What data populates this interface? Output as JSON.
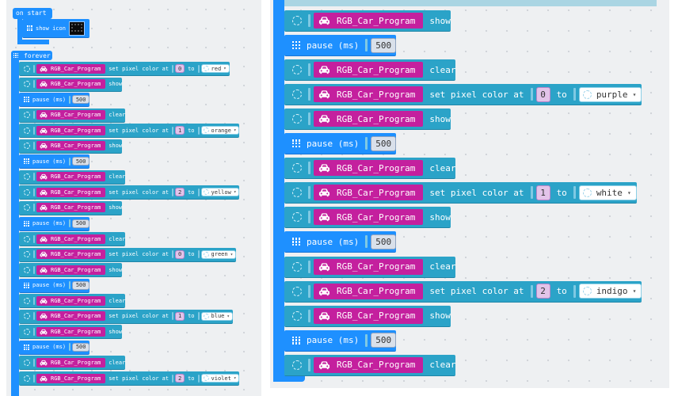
{
  "object_name": "RGB_Car_Program",
  "labels": {
    "on_start": "on start",
    "show_icon": "show icon",
    "forever": "forever",
    "set_pixel": "set pixel color at",
    "to": "to",
    "show": "show",
    "clear": "clear",
    "pause": "pause (ms)"
  },
  "pause_value": "500",
  "left_blocks": [
    {
      "kind": "set",
      "index": "0",
      "color": "red"
    },
    {
      "kind": "show"
    },
    {
      "kind": "pause"
    },
    {
      "kind": "clear"
    },
    {
      "kind": "set",
      "index": "1",
      "color": "orange"
    },
    {
      "kind": "show"
    },
    {
      "kind": "pause"
    },
    {
      "kind": "clear"
    },
    {
      "kind": "set",
      "index": "2",
      "color": "yellow"
    },
    {
      "kind": "show"
    },
    {
      "kind": "pause"
    },
    {
      "kind": "clear"
    },
    {
      "kind": "set",
      "index": "0",
      "color": "green"
    },
    {
      "kind": "show"
    },
    {
      "kind": "pause"
    },
    {
      "kind": "clear"
    },
    {
      "kind": "set",
      "index": "1",
      "color": "blue"
    },
    {
      "kind": "show"
    },
    {
      "kind": "pause"
    },
    {
      "kind": "clear"
    },
    {
      "kind": "set",
      "index": "2",
      "color": "violet"
    }
  ],
  "right_blocks": [
    {
      "kind": "show"
    },
    {
      "kind": "pause"
    },
    {
      "kind": "clear"
    },
    {
      "kind": "set",
      "index": "0",
      "color": "purple"
    },
    {
      "kind": "show"
    },
    {
      "kind": "pause"
    },
    {
      "kind": "clear"
    },
    {
      "kind": "set",
      "index": "1",
      "color": "white"
    },
    {
      "kind": "show"
    },
    {
      "kind": "pause"
    },
    {
      "kind": "clear"
    },
    {
      "kind": "set",
      "index": "2",
      "color": "indigo"
    },
    {
      "kind": "show"
    },
    {
      "kind": "pause"
    },
    {
      "kind": "clear"
    }
  ],
  "colors": {
    "basic_blue": "#1e90ff",
    "object_blue": "#2ba3c8",
    "object_magenta": "#c4209e",
    "workspace": "#eef0f2"
  },
  "icons": {
    "loop": "grid-icon",
    "object": "car-icon",
    "setting": "gear-icon",
    "dropdown": "chevron-down-icon"
  }
}
